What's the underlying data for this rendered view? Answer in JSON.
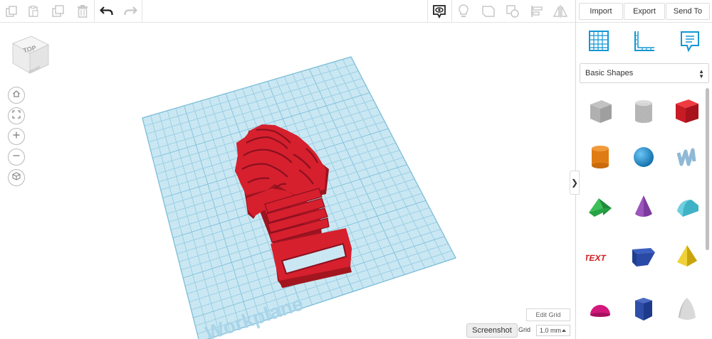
{
  "toolbar": {
    "tools": [
      {
        "name": "copy-icon",
        "enabled": false
      },
      {
        "name": "paste-icon",
        "enabled": false
      },
      {
        "name": "duplicate-icon",
        "enabled": false
      },
      {
        "name": "delete-icon",
        "enabled": false
      },
      {
        "name": "undo-icon",
        "enabled": true
      },
      {
        "name": "redo-icon",
        "enabled": false
      }
    ],
    "right_tools": [
      {
        "name": "show-hide-icon",
        "enabled": true
      },
      {
        "name": "light-bulb-icon",
        "enabled": false
      },
      {
        "name": "group-icon",
        "enabled": false
      },
      {
        "name": "ungroup-icon",
        "enabled": false
      },
      {
        "name": "align-icon",
        "enabled": false
      },
      {
        "name": "mirror-icon",
        "enabled": false
      }
    ]
  },
  "viewcube": {
    "top_label": "TOP",
    "front_label": "FRONT"
  },
  "view_controls": [
    "home-icon",
    "fit-view-icon",
    "zoom-in-icon",
    "zoom-out-icon",
    "perspective-icon"
  ],
  "workplane": {
    "label": "Workplane"
  },
  "grid": {
    "edit_label": "Edit Grid",
    "snap_label": "Snap Grid",
    "snap_visible_label": "Grid",
    "snap_value": "1.0 mm"
  },
  "screenshot_label": "Screenshot",
  "panel": {
    "buttons": {
      "import": "Import",
      "export": "Export",
      "send_to": "Send To"
    },
    "view_icons": [
      "workplane-icon",
      "ruler-icon",
      "notes-icon"
    ],
    "library_selected": "Basic Shapes",
    "shapes": [
      {
        "name": "box-hole-shape",
        "color": "#a9a9a9"
      },
      {
        "name": "cylinder-hole-shape",
        "color": "#b5b5b5"
      },
      {
        "name": "box-shape",
        "color": "#d9202a"
      },
      {
        "name": "cylinder-shape",
        "color": "#e07c14"
      },
      {
        "name": "sphere-shape",
        "color": "#1f8fd3"
      },
      {
        "name": "scribble-shape",
        "color": "#8fb9d6"
      },
      {
        "name": "roof-shape",
        "color": "#2ea046"
      },
      {
        "name": "cone-shape",
        "color": "#7e3a9e"
      },
      {
        "name": "round-roof-shape",
        "color": "#3fb2c6"
      },
      {
        "name": "text-shape",
        "color": "#d31f25"
      },
      {
        "name": "wedge-shape",
        "color": "#1f3f8f"
      },
      {
        "name": "pyramid-shape",
        "color": "#e6c214"
      },
      {
        "name": "half-sphere-shape",
        "color": "#d2187c"
      },
      {
        "name": "polygon-shape",
        "color": "#1e3a8a"
      },
      {
        "name": "paraboloid-shape",
        "color": "#cfcfcf"
      }
    ]
  },
  "colors": {
    "accent": "#0f9de0",
    "grid_fill": "#cbe8f3",
    "grid_line": "#97cde4",
    "model": "#d6202e"
  }
}
